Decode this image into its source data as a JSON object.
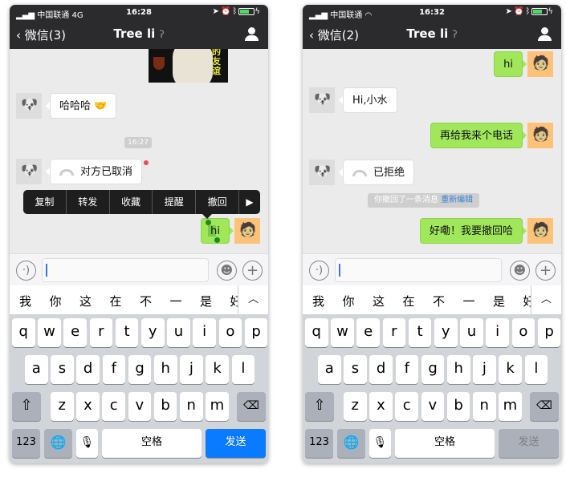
{
  "phones": [
    {
      "status": {
        "carrier": "中国联通",
        "network": "4G",
        "time": "16:28"
      },
      "nav": {
        "back": "微信(3)",
        "title": "Tree li"
      },
      "sticker_text": "的友谊",
      "messages": [
        {
          "side": "left",
          "text": "哈哈哈 🤝"
        },
        {
          "type": "time",
          "text": "16:27"
        },
        {
          "side": "left",
          "type": "call",
          "text": "对方已取消",
          "unread_dot": true
        },
        {
          "side": "right",
          "text": "hi",
          "selected": true
        }
      ],
      "context_menu": [
        "复制",
        "转发",
        "收藏",
        "提醒",
        "撤回",
        "▶"
      ],
      "send_label": "发送",
      "send_active": true
    },
    {
      "status": {
        "carrier": "中国联通",
        "network": "wifi",
        "time": "16:32"
      },
      "nav": {
        "back": "微信(2)",
        "title": "Tree li"
      },
      "messages": [
        {
          "side": "right",
          "text": "hi"
        },
        {
          "side": "left",
          "text": "Hi,小水"
        },
        {
          "side": "right",
          "text": "再给我来个电话"
        },
        {
          "side": "left",
          "type": "call",
          "text": "已拒绝"
        },
        {
          "type": "system",
          "text": "你撤回了一条消息",
          "link": "重新编辑"
        },
        {
          "side": "right",
          "text": "好嘞！我要撤回哈"
        }
      ],
      "send_label": "发送",
      "send_active": false
    }
  ],
  "candidates": [
    "我",
    "你",
    "这",
    "在",
    "不",
    "一",
    "是",
    "好"
  ],
  "keyboard": {
    "row1": [
      "q",
      "w",
      "e",
      "r",
      "t",
      "y",
      "u",
      "i",
      "o",
      "p"
    ],
    "row2": [
      "a",
      "s",
      "d",
      "f",
      "g",
      "h",
      "j",
      "k",
      "l"
    ],
    "row3": [
      "z",
      "x",
      "c",
      "v",
      "b",
      "n",
      "m"
    ],
    "numbers": "123",
    "space": "空格"
  },
  "colors": {
    "accent": "#0a7aff",
    "bubble_green": "#a0e75a",
    "nav_bg": "#2b2b2d"
  }
}
